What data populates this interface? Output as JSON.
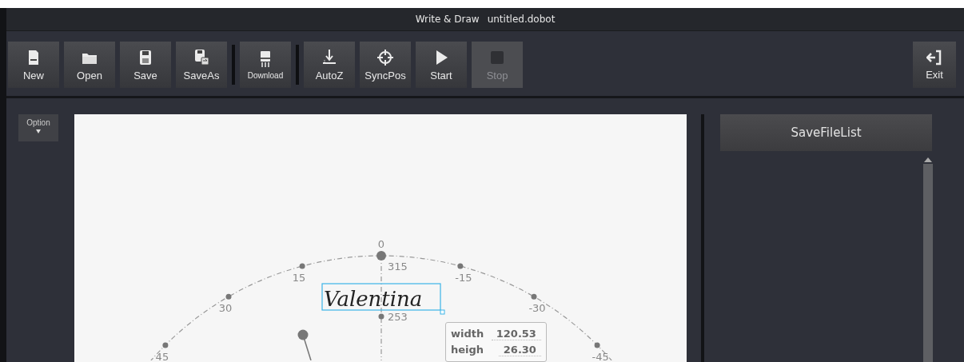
{
  "title_bar": {
    "app": "Write & Draw",
    "file": "untitled.dobot"
  },
  "toolbar": {
    "groups": [
      [
        {
          "label": "New",
          "kind": "new",
          "disabled": false
        },
        {
          "label": "Open",
          "kind": "open",
          "disabled": false
        },
        {
          "label": "Save",
          "kind": "save",
          "disabled": false
        },
        {
          "label": "SaveAs",
          "kind": "saveas",
          "disabled": false
        }
      ],
      [
        {
          "label": "Download",
          "kind": "download",
          "disabled": false
        }
      ],
      [
        {
          "label": "AutoZ",
          "kind": "autoz",
          "disabled": false
        },
        {
          "label": "SyncPos",
          "kind": "syncpos",
          "disabled": false
        },
        {
          "label": "Start",
          "kind": "start",
          "disabled": false
        },
        {
          "label": "Stop",
          "kind": "stop",
          "disabled": true
        }
      ]
    ],
    "exit": {
      "label": "Exit"
    }
  },
  "option_button": {
    "label": "Option"
  },
  "canvas": {
    "dial_labels": [
      "45",
      "30",
      "15",
      "0",
      "-15",
      "-30",
      "-45"
    ],
    "top_reading": "315",
    "lower_reading": "253",
    "text_object": {
      "text": "Valentina",
      "selected": true
    },
    "size_box": [
      {
        "label": "width",
        "value": "120.53"
      },
      {
        "label": "heigh",
        "value": "26.30"
      }
    ]
  },
  "side_panel": {
    "button": "SaveFileList"
  }
}
